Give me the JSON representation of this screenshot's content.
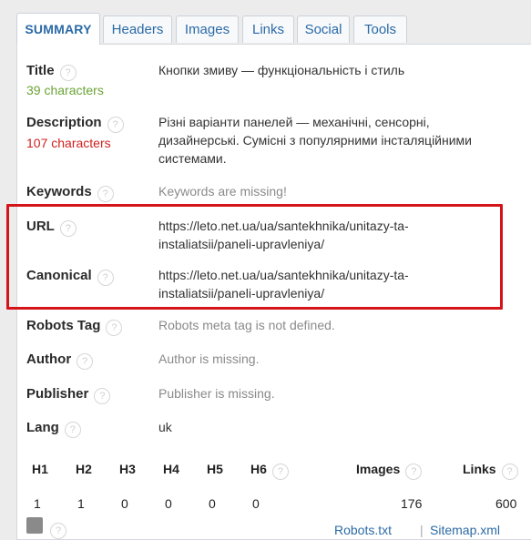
{
  "tabs": [
    {
      "label": "SUMMARY"
    },
    {
      "label": "Headers"
    },
    {
      "label": "Images"
    },
    {
      "label": "Links"
    },
    {
      "label": "Social"
    },
    {
      "label": "Tools"
    }
  ],
  "help_glyph": "?",
  "title": {
    "label": "Title",
    "count": "39 characters",
    "value": "Кнопки змиву — функціональність і стиль"
  },
  "description": {
    "label": "Description",
    "count": "107 characters",
    "value": "Різні варіанти панелей — механічні, сенсорні, дизайнерські. Сумісні з популярними інсталяційними системами."
  },
  "keywords": {
    "label": "Keywords",
    "value": "Keywords are missing!"
  },
  "url": {
    "label": "URL",
    "value": "https://leto.net.ua/ua/santekhnika/unitazy-ta-instaliatsii/paneli-upravleniya/"
  },
  "canonical": {
    "label": "Canonical",
    "value": "https://leto.net.ua/ua/santekhnika/unitazy-ta-instaliatsii/paneli-upravleniya/"
  },
  "robots_tag": {
    "label": "Robots Tag",
    "value": "Robots meta tag is not defined."
  },
  "author": {
    "label": "Author",
    "value": "Author is missing."
  },
  "publisher": {
    "label": "Publisher",
    "value": "Publisher is missing."
  },
  "lang": {
    "label": "Lang",
    "value": "uk"
  },
  "headings_stats": {
    "headers": [
      "H1",
      "H2",
      "H3",
      "H4",
      "H5",
      "H6",
      "Images",
      "Links"
    ],
    "values": [
      "1",
      "1",
      "0",
      "0",
      "0",
      "0",
      "176",
      "600"
    ]
  },
  "footer": {
    "robots_link": "Robots.txt",
    "separator": "|",
    "sitemap_link": "Sitemap.xml"
  },
  "colors": {
    "accent": "#2b6aa6",
    "good": "#6aa336",
    "bad": "#d0211f",
    "highlight": "#d5141a"
  }
}
